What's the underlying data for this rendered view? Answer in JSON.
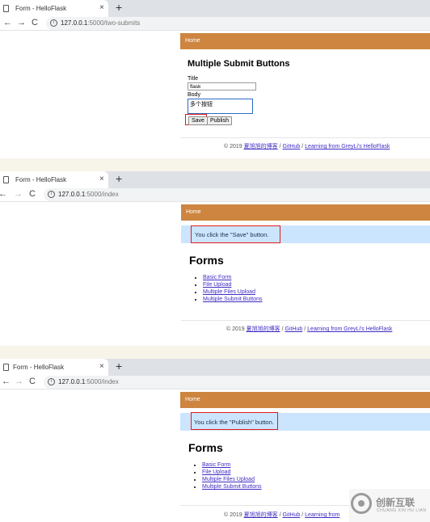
{
  "browser": {
    "tab_title": "Form - HelloFlask",
    "new_tab": "+",
    "close": "×",
    "back": "←",
    "forward": "→",
    "reload": "C",
    "info": "i"
  },
  "shots": [
    {
      "url_host": "127.0.0.1",
      "url_path": ":5000/two-submits"
    },
    {
      "url_host": "127.0.0.1",
      "url_path": ":5000/index"
    },
    {
      "url_host": "127.0.0.1",
      "url_path": ":5000/index"
    }
  ],
  "navbar": {
    "home": "Home"
  },
  "form_page": {
    "title": "Multiple Submit Buttons",
    "title_label": "Title",
    "title_value": "flask",
    "body_label": "Body",
    "body_value": "多个按钮",
    "save_label": "Save",
    "publish_label": "Publish"
  },
  "index_page": {
    "heading": "Forms",
    "links": [
      "Basic Form",
      "File Upload",
      "Multiple Files Upload",
      "Multiple Submit Buttons"
    ],
    "flash_save": "You click the \"Save\" button.",
    "flash_publish": "You click the \"Publish\" button."
  },
  "footer": {
    "copyright": "© 2019",
    "author_link": "夏旭旭的博客",
    "sep": "/",
    "github": "GitHub",
    "learning": "Learning from GreyLi's HelloFlask",
    "learning_cut": "Learning from"
  },
  "watermark": {
    "text": "创新互联",
    "sub": "CHUANG XIN HU LIAN"
  },
  "colors": {
    "navbar": "#cd853f",
    "flash": "#cce5ff",
    "highlight": "#e21b1b",
    "gap": "#f7f4ea"
  }
}
